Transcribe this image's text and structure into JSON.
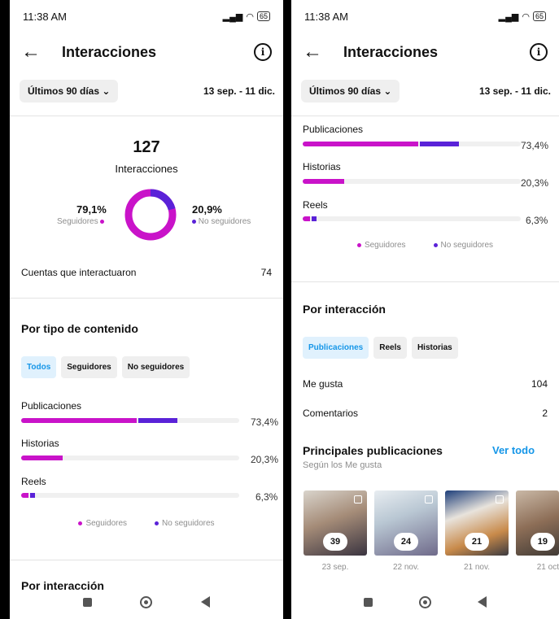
{
  "status": {
    "time": "11:38 AM",
    "battery": "65"
  },
  "header": {
    "title": "Interacciones",
    "back_icon": "arrow-left-icon",
    "info_icon": "info-icon"
  },
  "range": {
    "label": "Últimos 90 días",
    "dates": "13 sep. - 11 dic."
  },
  "summary": {
    "total": "127",
    "total_label": "Interacciones",
    "followers_pct": "79,1%",
    "followers_label": "Seguidores",
    "nonfollowers_pct": "20,9%",
    "nonfollowers_label": "No seguidores",
    "followers_share": 0.791
  },
  "accounts": {
    "label": "Cuentas que interactuaron",
    "value": "74"
  },
  "by_content": {
    "title": "Por tipo de contenido",
    "chips": [
      "Todos",
      "Seguidores",
      "No seguidores"
    ],
    "bars": [
      {
        "label": "Publicaciones",
        "pct": "73,4%",
        "followers": 0.53,
        "nonfollowers": 0.18
      },
      {
        "label": "Historias",
        "pct": "20,3%",
        "followers": 0.19,
        "nonfollowers": 0.0
      },
      {
        "label": "Reels",
        "pct": "6,3%",
        "followers": 0.035,
        "nonfollowers": 0.02
      }
    ],
    "legend": [
      "Seguidores",
      "No seguidores"
    ]
  },
  "by_interaction": {
    "title": "Por interacción",
    "chips": [
      "Publicaciones",
      "Reels",
      "Historias"
    ],
    "rows": [
      {
        "label": "Me gusta",
        "value": "104"
      },
      {
        "label": "Comentarios",
        "value": "2"
      }
    ]
  },
  "top_posts": {
    "title": "Principales publicaciones",
    "subtitle": "Según los Me gusta",
    "see_all": "Ver todo",
    "posts": [
      {
        "count": "39",
        "date": "23 sep."
      },
      {
        "count": "24",
        "date": "22 nov."
      },
      {
        "count": "21",
        "date": "21 nov."
      },
      {
        "count": "19",
        "date": "21 oct"
      }
    ]
  },
  "colors": {
    "followers": "#c913c9",
    "nonfollowers": "#5a22d8",
    "accent": "#1596e8"
  }
}
